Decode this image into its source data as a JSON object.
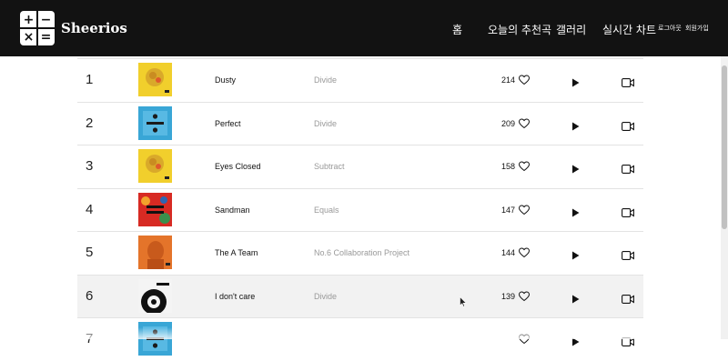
{
  "header": {
    "brand": "Sheerios",
    "logo_symbols": [
      "+",
      "−",
      "×",
      "="
    ],
    "nav": {
      "home": "홈",
      "recommend": "오늘의 추천곡",
      "gallery": "갤러리",
      "chart": "실시간 차트",
      "logout": "로그아웃",
      "signup": "회원가입"
    },
    "colors": {
      "background": "#121212",
      "text": "#ffffff"
    }
  },
  "chart": {
    "rows": [
      {
        "rank": "1",
        "title": "Dusty",
        "album": "Divide",
        "likes": "214",
        "art": "yellow",
        "hover": false
      },
      {
        "rank": "2",
        "title": "Perfect",
        "album": "Divide",
        "likes": "209",
        "art": "blue",
        "hover": false
      },
      {
        "rank": "3",
        "title": "Eyes Closed",
        "album": "Subtract",
        "likes": "158",
        "art": "yellow",
        "hover": false
      },
      {
        "rank": "4",
        "title": "Sandman",
        "album": "Equals",
        "likes": "147",
        "art": "red",
        "hover": false
      },
      {
        "rank": "5",
        "title": "The A Team",
        "album": "No.6 Collaboration Project",
        "likes": "144",
        "art": "orange",
        "hover": false
      },
      {
        "rank": "6",
        "title": "I don't care",
        "album": "Divide",
        "likes": "139",
        "art": "bw",
        "hover": true
      },
      {
        "rank": "7",
        "title": "",
        "album": "",
        "likes": "",
        "art": "blue",
        "hover": false
      }
    ],
    "icons": {
      "like": "heart-icon",
      "play": "play-icon",
      "video": "video-icon"
    },
    "colors": {
      "album_text": "#999999",
      "row_hover": "#f2f2f2",
      "divider": "#e3e3e3"
    }
  }
}
